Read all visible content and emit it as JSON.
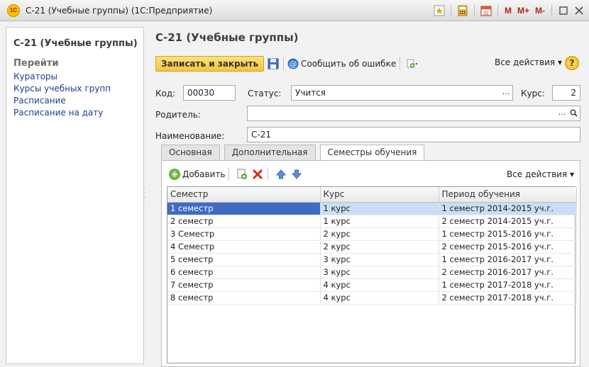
{
  "window": {
    "title": "С-21 (Учебные группы) (1С:Предприятие)",
    "logo_text": "1С",
    "tools": {
      "m": "M",
      "mplus": "M+",
      "mminus": "M-"
    }
  },
  "nav": {
    "title": "С-21 (Учебные группы)",
    "section": "Перейти",
    "links": [
      "Кураторы",
      "Курсы учебных групп",
      "Расписание",
      "Расписание на дату"
    ]
  },
  "form": {
    "title": "С-21 (Учебные группы)",
    "toolbar": {
      "save_close": "Записать и закрыть",
      "report_error": "Сообщить об ошибке",
      "all_actions": "Все действия ▾",
      "help": "?"
    },
    "fields": {
      "code_label": "Код:",
      "code_value": "00030",
      "status_label": "Статус:",
      "status_value": "Учится",
      "course_label": "Курс:",
      "course_value": "2",
      "parent_label": "Родитель:",
      "parent_value": "",
      "name_label": "Наименование:",
      "name_value": "С-21"
    },
    "tabs": [
      "Основная",
      "Дополнительная",
      "Семестры обучения"
    ],
    "active_tab": 2,
    "table_toolbar": {
      "add": "Добавить",
      "all_actions": "Все действия ▾"
    },
    "table": {
      "columns": [
        "Семестр",
        "Курс",
        "Период обучения"
      ],
      "rows": [
        [
          "1 семестр",
          "1 курс",
          "1 семестр 2014-2015 уч.г."
        ],
        [
          "2 семестр",
          "1 курс",
          "2 семестр 2014-2015 уч.г."
        ],
        [
          "3 Семестр",
          "2 курс",
          "1 семестр 2015-2016 уч.г."
        ],
        [
          "4 Семестр",
          "2 курс",
          "2 семестр 2015-2016 уч.г."
        ],
        [
          "5 семестр",
          "3 курс",
          "1 семестр 2016-2017 уч.г."
        ],
        [
          "6 семестр",
          "3 курс",
          "2 семестр 2016-2017 уч.г."
        ],
        [
          "7 семестр",
          "4 курс",
          "1 семестр 2017-2018 уч.г."
        ],
        [
          "8 семестр",
          "4 курс",
          "2 семестр 2017-2018 уч.г."
        ]
      ],
      "selected_row": 0
    }
  },
  "colors": {
    "accent_button": "#f6c53a",
    "link": "#1b3f8e",
    "selection": "#3f6bc2",
    "selection_row": "#c9def5"
  }
}
